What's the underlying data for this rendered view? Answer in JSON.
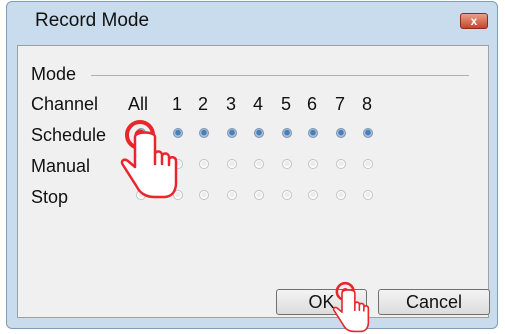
{
  "window": {
    "title": "Record Mode",
    "close_label": "x"
  },
  "mode": {
    "label": "Mode"
  },
  "header": {
    "channel_label": "Channel",
    "all_label": "All",
    "channels": [
      "1",
      "2",
      "3",
      "4",
      "5",
      "6",
      "7",
      "8"
    ]
  },
  "rows": [
    {
      "label": "Schedule",
      "state": "selected"
    },
    {
      "label": "Manual",
      "state": "unselected"
    },
    {
      "label": "Stop",
      "state": "unselected"
    }
  ],
  "buttons": {
    "ok_label": "OK",
    "cancel_label": "Cancel"
  },
  "colors": {
    "highlight_red": "#e8262b",
    "radio_selected": "#4a7fb5"
  },
  "icons": [
    "close-icon",
    "hand-pointer-icon"
  ]
}
